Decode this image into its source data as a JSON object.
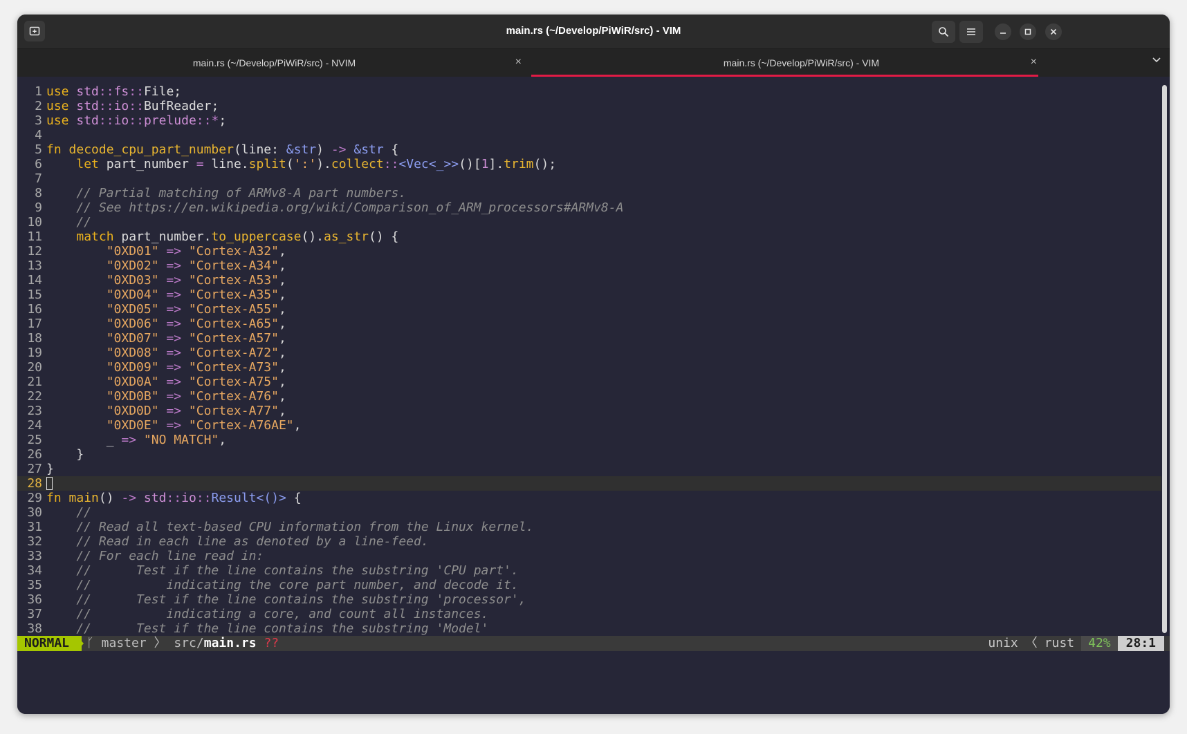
{
  "window": {
    "title": "main.rs (~/Develop/PiWiR/src) - VIM"
  },
  "header": {
    "new_tab_icon": "new-tab-icon",
    "search_icon": "search-icon",
    "menu_icon": "hamburger-menu-icon",
    "minimize_icon": "minimize-icon",
    "maximize_icon": "maximize-icon",
    "close_icon": "close-icon"
  },
  "tabs": [
    {
      "label": "main.rs (~/Develop/PiWiR/src) - NVIM",
      "close": "×",
      "active": false
    },
    {
      "label": "main.rs (~/Develop/PiWiR/src) - VIM",
      "close": "×",
      "active": true
    }
  ],
  "tab_overflow_icon": "chevron-down-icon",
  "editor": {
    "current_line": 28,
    "lines": [
      {
        "n": "1",
        "t": [
          [
            "kw",
            "use "
          ],
          [
            "ty",
            "std"
          ],
          [
            "pt",
            "::"
          ],
          [
            "ty",
            "fs"
          ],
          [
            "pt",
            "::"
          ],
          [
            "",
            "File;"
          ]
        ]
      },
      {
        "n": "2",
        "t": [
          [
            "kw",
            "use "
          ],
          [
            "ty",
            "std"
          ],
          [
            "pt",
            "::"
          ],
          [
            "ty",
            "io"
          ],
          [
            "pt",
            "::"
          ],
          [
            "",
            "BufReader;"
          ]
        ]
      },
      {
        "n": "3",
        "t": [
          [
            "kw",
            "use "
          ],
          [
            "ty",
            "std"
          ],
          [
            "pt",
            "::"
          ],
          [
            "ty",
            "io"
          ],
          [
            "pt",
            "::"
          ],
          [
            "ty",
            "prelude"
          ],
          [
            "pt",
            "::*"
          ],
          [
            "",
            ";"
          ]
        ]
      },
      {
        "n": "4",
        "t": []
      },
      {
        "n": "5",
        "t": [
          [
            "kw",
            "fn "
          ],
          [
            "fn",
            "decode_cpu_part_number"
          ],
          [
            "",
            "(line: "
          ],
          [
            "am",
            "&str"
          ],
          [
            "",
            ") "
          ],
          [
            "pt",
            "->"
          ],
          [
            "am",
            " &str"
          ],
          [
            "",
            " {"
          ]
        ]
      },
      {
        "n": "6",
        "t": [
          [
            "",
            "    "
          ],
          [
            "kw",
            "let "
          ],
          [
            "",
            "part_number "
          ],
          [
            "pt",
            "="
          ],
          [
            "",
            " line."
          ],
          [
            "fn",
            "split"
          ],
          [
            "",
            "("
          ],
          [
            "st",
            "':'"
          ],
          [
            "",
            ")."
          ],
          [
            "fn",
            "collect"
          ],
          [
            "pt",
            "::"
          ],
          [
            "am",
            "<Vec<_>>"
          ],
          [
            "",
            "()["
          ],
          [
            "ty",
            "1"
          ],
          [
            "",
            "]."
          ],
          [
            "fn",
            "trim"
          ],
          [
            "",
            "();"
          ]
        ]
      },
      {
        "n": "7",
        "t": []
      },
      {
        "n": "8",
        "t": [
          [
            "cm",
            "    // Partial matching of ARMv8-A part numbers."
          ]
        ]
      },
      {
        "n": "9",
        "t": [
          [
            "cm",
            "    // See https://en.wikipedia.org/wiki/Comparison_of_ARM_processors#ARMv8-A"
          ]
        ]
      },
      {
        "n": "10",
        "t": [
          [
            "cm",
            "    //"
          ]
        ]
      },
      {
        "n": "11",
        "t": [
          [
            "",
            "    "
          ],
          [
            "kw",
            "match "
          ],
          [
            "",
            "part_number."
          ],
          [
            "fn",
            "to_uppercase"
          ],
          [
            "",
            "()."
          ],
          [
            "fn",
            "as_str"
          ],
          [
            "",
            "() {"
          ]
        ]
      },
      {
        "n": "12",
        "t": [
          [
            "",
            "        "
          ],
          [
            "st",
            "\"0XD01\""
          ],
          [
            "pt",
            " =>"
          ],
          [
            "st",
            " \"Cortex-A32\""
          ],
          [
            "",
            ","
          ]
        ]
      },
      {
        "n": "13",
        "t": [
          [
            "",
            "        "
          ],
          [
            "st",
            "\"0XD02\""
          ],
          [
            "pt",
            " =>"
          ],
          [
            "st",
            " \"Cortex-A34\""
          ],
          [
            "",
            ","
          ]
        ]
      },
      {
        "n": "14",
        "t": [
          [
            "",
            "        "
          ],
          [
            "st",
            "\"0XD03\""
          ],
          [
            "pt",
            " =>"
          ],
          [
            "st",
            " \"Cortex-A53\""
          ],
          [
            "",
            ","
          ]
        ]
      },
      {
        "n": "15",
        "t": [
          [
            "",
            "        "
          ],
          [
            "st",
            "\"0XD04\""
          ],
          [
            "pt",
            " =>"
          ],
          [
            "st",
            " \"Cortex-A35\""
          ],
          [
            "",
            ","
          ]
        ]
      },
      {
        "n": "16",
        "t": [
          [
            "",
            "        "
          ],
          [
            "st",
            "\"0XD05\""
          ],
          [
            "pt",
            " =>"
          ],
          [
            "st",
            " \"Cortex-A55\""
          ],
          [
            "",
            ","
          ]
        ]
      },
      {
        "n": "17",
        "t": [
          [
            "",
            "        "
          ],
          [
            "st",
            "\"0XD06\""
          ],
          [
            "pt",
            " =>"
          ],
          [
            "st",
            " \"Cortex-A65\""
          ],
          [
            "",
            ","
          ]
        ]
      },
      {
        "n": "18",
        "t": [
          [
            "",
            "        "
          ],
          [
            "st",
            "\"0XD07\""
          ],
          [
            "pt",
            " =>"
          ],
          [
            "st",
            " \"Cortex-A57\""
          ],
          [
            "",
            ","
          ]
        ]
      },
      {
        "n": "19",
        "t": [
          [
            "",
            "        "
          ],
          [
            "st",
            "\"0XD08\""
          ],
          [
            "pt",
            " =>"
          ],
          [
            "st",
            " \"Cortex-A72\""
          ],
          [
            "",
            ","
          ]
        ]
      },
      {
        "n": "20",
        "t": [
          [
            "",
            "        "
          ],
          [
            "st",
            "\"0XD09\""
          ],
          [
            "pt",
            " =>"
          ],
          [
            "st",
            " \"Cortex-A73\""
          ],
          [
            "",
            ","
          ]
        ]
      },
      {
        "n": "21",
        "t": [
          [
            "",
            "        "
          ],
          [
            "st",
            "\"0XD0A\""
          ],
          [
            "pt",
            " =>"
          ],
          [
            "st",
            " \"Cortex-A75\""
          ],
          [
            "",
            ","
          ]
        ]
      },
      {
        "n": "22",
        "t": [
          [
            "",
            "        "
          ],
          [
            "st",
            "\"0XD0B\""
          ],
          [
            "pt",
            " =>"
          ],
          [
            "st",
            " \"Cortex-A76\""
          ],
          [
            "",
            ","
          ]
        ]
      },
      {
        "n": "23",
        "t": [
          [
            "",
            "        "
          ],
          [
            "st",
            "\"0XD0D\""
          ],
          [
            "pt",
            " =>"
          ],
          [
            "st",
            " \"Cortex-A77\""
          ],
          [
            "",
            ","
          ]
        ]
      },
      {
        "n": "24",
        "t": [
          [
            "",
            "        "
          ],
          [
            "st",
            "\"0XD0E\""
          ],
          [
            "pt",
            " =>"
          ],
          [
            "st",
            " \"Cortex-A76AE\""
          ],
          [
            "",
            ","
          ]
        ]
      },
      {
        "n": "25",
        "t": [
          [
            "",
            "        _ "
          ],
          [
            "pt",
            "=>"
          ],
          [
            "st",
            " \"NO MATCH\""
          ],
          [
            "",
            ","
          ]
        ]
      },
      {
        "n": "26",
        "t": [
          [
            "",
            "    }"
          ]
        ]
      },
      {
        "n": "27",
        "t": [
          [
            "",
            "}"
          ]
        ]
      },
      {
        "n": "28",
        "t": []
      },
      {
        "n": "29",
        "t": [
          [
            "kw",
            "fn "
          ],
          [
            "fn",
            "main"
          ],
          [
            "",
            "() "
          ],
          [
            "pt",
            "->"
          ],
          [
            "ty",
            " std"
          ],
          [
            "pt",
            "::"
          ],
          [
            "ty",
            "io"
          ],
          [
            "pt",
            "::"
          ],
          [
            "am",
            "Result<()>"
          ],
          [
            "",
            " {"
          ]
        ]
      },
      {
        "n": "30",
        "t": [
          [
            "cm",
            "    //"
          ]
        ]
      },
      {
        "n": "31",
        "t": [
          [
            "cm",
            "    // Read all text-based CPU information from the Linux kernel."
          ]
        ]
      },
      {
        "n": "32",
        "t": [
          [
            "cm",
            "    // Read in each line as denoted by a line-feed."
          ]
        ]
      },
      {
        "n": "33",
        "t": [
          [
            "cm",
            "    // For each line read in:"
          ]
        ]
      },
      {
        "n": "34",
        "t": [
          [
            "cm",
            "    //      Test if the line contains the substring 'CPU part'."
          ]
        ]
      },
      {
        "n": "35",
        "t": [
          [
            "cm",
            "    //          indicating the core part number, and decode it."
          ]
        ]
      },
      {
        "n": "36",
        "t": [
          [
            "cm",
            "    //      Test if the line contains the substring 'processor',"
          ]
        ]
      },
      {
        "n": "37",
        "t": [
          [
            "cm",
            "    //          indicating a core, and count all instances."
          ]
        ]
      },
      {
        "n": "38",
        "t": [
          [
            "cm",
            "    //      Test if the line contains the substring 'Model'"
          ]
        ]
      }
    ]
  },
  "statusline": {
    "mode": "NORMAL",
    "branch": "master",
    "path_dir": "src/",
    "path_file": "main.rs",
    "modified": "??",
    "fileformat": "unix",
    "filetype": "rust",
    "percent": "42%",
    "line_col": "28:1"
  }
}
